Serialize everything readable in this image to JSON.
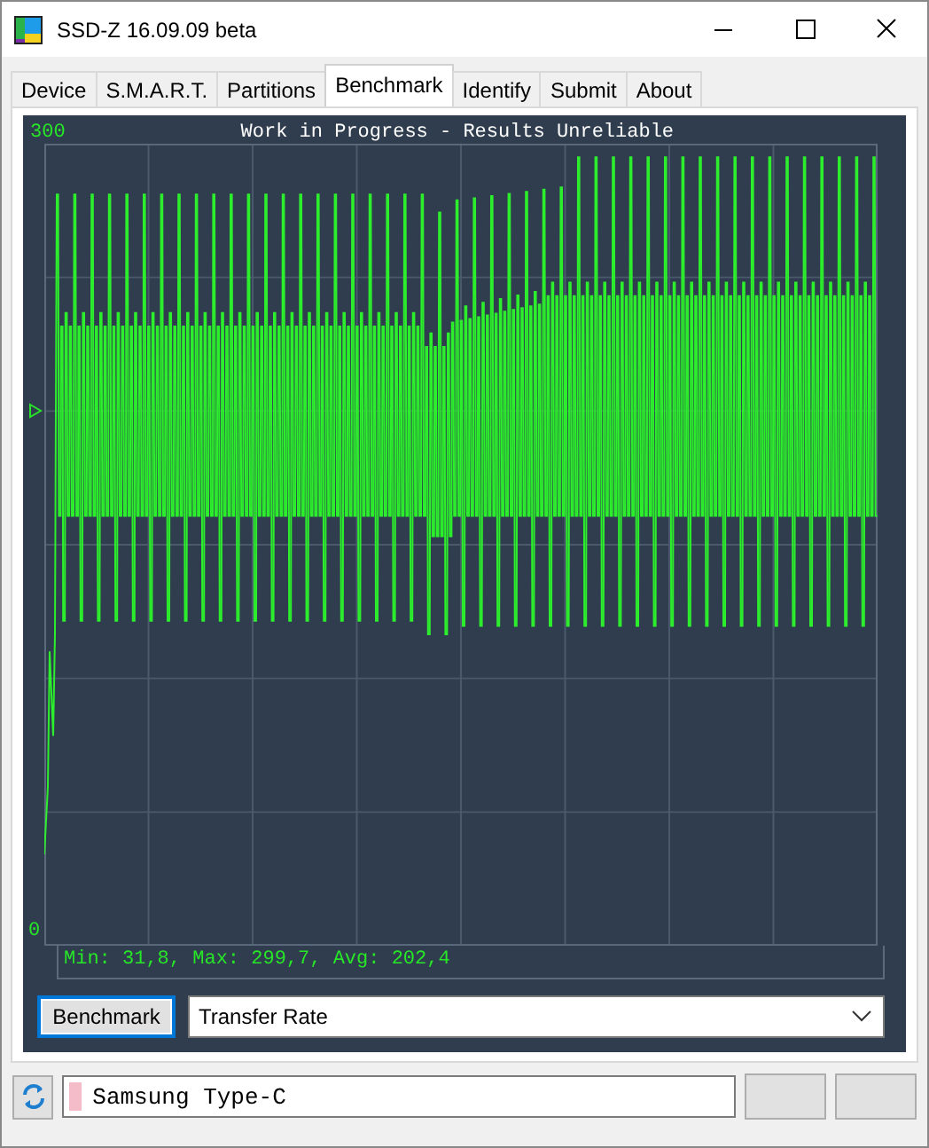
{
  "window": {
    "title": "SSD-Z 16.09.09 beta"
  },
  "tabs": [
    {
      "label": "Device",
      "selected": false
    },
    {
      "label": "S.M.A.R.T.",
      "selected": false
    },
    {
      "label": "Partitions",
      "selected": false
    },
    {
      "label": "Benchmark",
      "selected": true
    },
    {
      "label": "Identify",
      "selected": false
    },
    {
      "label": "Submit",
      "selected": false
    },
    {
      "label": "About",
      "selected": false
    }
  ],
  "graph": {
    "title": "Work in Progress - Results Unreliable",
    "y_max_label": "300",
    "y_min_label": "0",
    "stats": "Min: 31,8, Max: 299,7, Avg: 202,4"
  },
  "benchmark_button": "Benchmark",
  "mode_dropdown": {
    "value": "Transfer Rate"
  },
  "status": {
    "device": "Samsung Type-C"
  }
}
